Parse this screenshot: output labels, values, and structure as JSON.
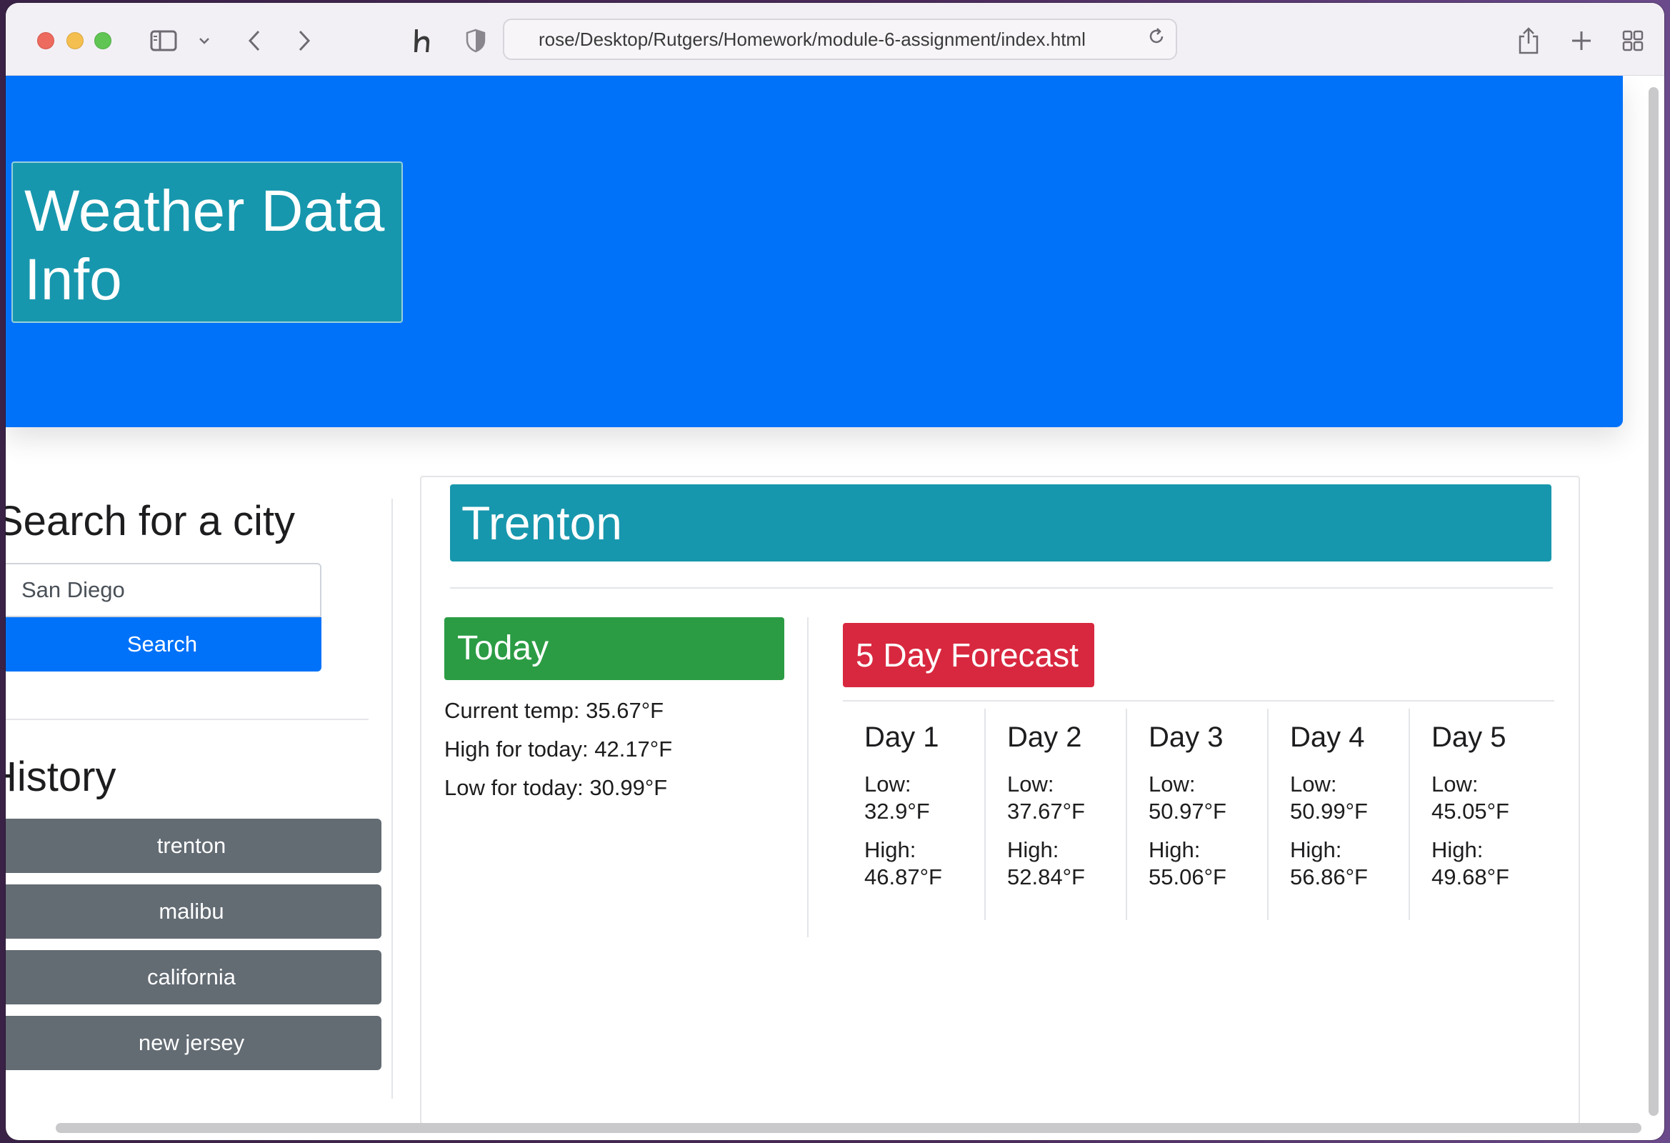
{
  "browser": {
    "url": "rose/Desktop/Rutgers/Homework/module-6-assignment/index.html"
  },
  "hero": {
    "title_line1": "Weather Data",
    "title_line2": "Info"
  },
  "search": {
    "heading": "Search for a city",
    "input_value": "San Diego",
    "button_label": "Search"
  },
  "history": {
    "heading": "History",
    "items": [
      "trenton",
      "malibu",
      "california",
      "new jersey"
    ]
  },
  "city": {
    "name": "Trenton"
  },
  "today": {
    "label": "Today",
    "current_temp": "Current temp: 35.67°F",
    "high": "High for today: 42.17°F",
    "low": "Low for today: 30.99°F"
  },
  "forecast": {
    "label": "5 Day Forecast",
    "low_label": "Low:",
    "high_label": "High:",
    "days": [
      {
        "title": "Day 1",
        "low": "32.9°F",
        "high": "46.87°F"
      },
      {
        "title": "Day 2",
        "low": "37.67°F",
        "high": "52.84°F"
      },
      {
        "title": "Day 3",
        "low": "50.97°F",
        "high": "55.06°F"
      },
      {
        "title": "Day 4",
        "low": "50.99°F",
        "high": "56.86°F"
      },
      {
        "title": "Day 5",
        "low": "45.05°F",
        "high": "49.68°F"
      }
    ]
  },
  "colors": {
    "hero_blue": "#0072f9",
    "teal": "#1797ad",
    "green": "#2b9c44",
    "red": "#d8283f",
    "history_gray": "#636b73"
  },
  "icons": {
    "sidebar_toggle": "sidebar-icon",
    "back": "chevron-left-icon",
    "forward": "chevron-right-icon",
    "extension": "honey-h-icon",
    "privacy": "shield-icon",
    "reload": "reload-icon",
    "share": "share-icon",
    "new_tab": "plus-icon",
    "tab_overview": "grid-icon"
  }
}
